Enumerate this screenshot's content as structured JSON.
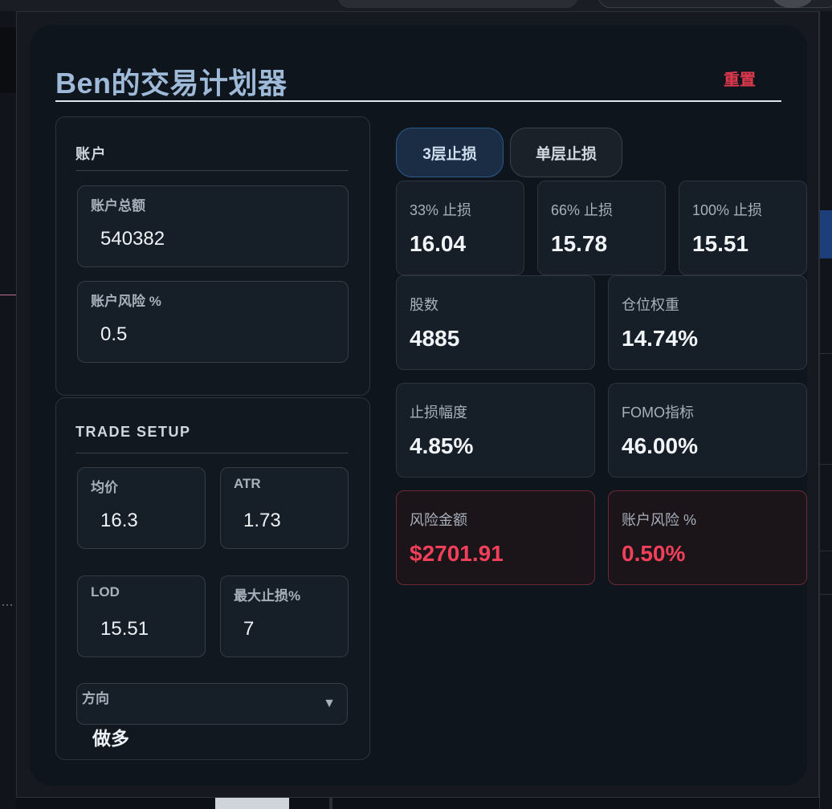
{
  "app": {
    "title": "Ben的交易计划器",
    "reset_label": "重置"
  },
  "account": {
    "title": "账户",
    "total_label": "账户总额",
    "total_value": "540382",
    "risk_label": "账户风险 %",
    "risk_value": "0.5"
  },
  "trade_setup": {
    "title": "TRADE SETUP",
    "avg_price_label": "均价",
    "avg_price_value": "16.3",
    "atr_label": "ATR",
    "atr_value": "1.73",
    "lod_label": "LOD",
    "lod_value": "15.51",
    "max_stop_label": "最大止损%",
    "max_stop_value": "7",
    "direction_label": "方向",
    "direction_value": "做多",
    "direction_caret": "▼"
  },
  "tabs": [
    {
      "label": "3层止损",
      "active": true
    },
    {
      "label": "单层止损",
      "active": false
    }
  ],
  "stops": [
    {
      "label": "33% 止损",
      "value": "16.04"
    },
    {
      "label": "66% 止损",
      "value": "15.78"
    },
    {
      "label": "100% 止损",
      "value": "15.51"
    }
  ],
  "metrics": {
    "shares_label": "股数",
    "shares_value": "4885",
    "weight_label": "仓位权重",
    "weight_value": "14.74%",
    "stop_pct_label": "止损幅度",
    "stop_pct_value": "4.85%",
    "fomo_label": "FOMO指标",
    "fomo_value": "46.00%",
    "risk_amount_label": "风险金额",
    "risk_amount_value": "$2701.91",
    "account_risk_label": "账户风险 %",
    "account_risk_value": "0.50%"
  },
  "colors": {
    "accent_red": "#f0405a",
    "title_blue": "#9ebad8",
    "tab_active_bg": "#1a2d45"
  }
}
